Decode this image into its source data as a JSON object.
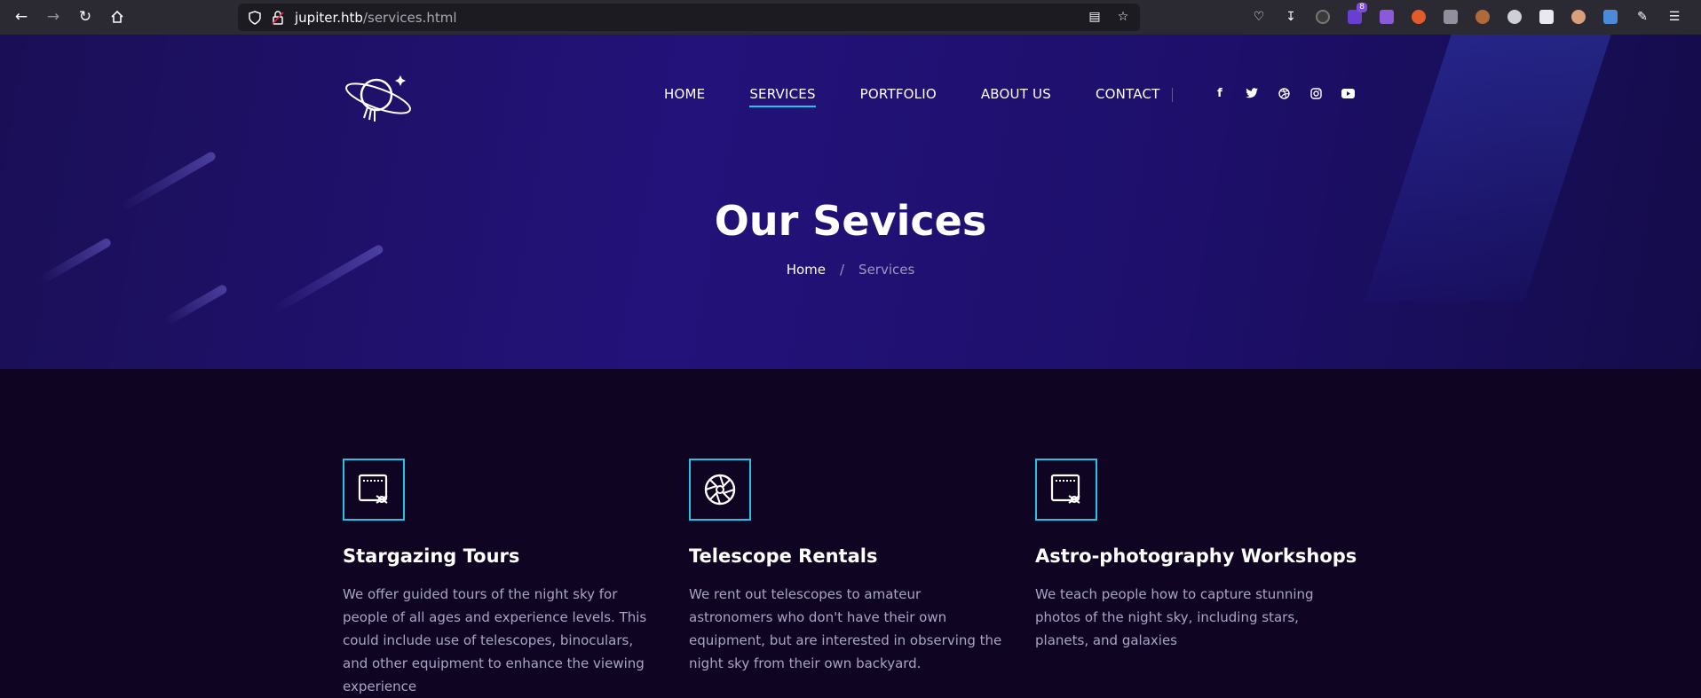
{
  "browser": {
    "back_icon": "back-arrow-icon",
    "forward_icon": "forward-arrow-icon",
    "reload_icon": "reload-icon",
    "home_icon": "home-icon",
    "url_host": "jupiter.htb",
    "url_path": "/services.html",
    "extension_badge": "8"
  },
  "nav": {
    "items": [
      {
        "label": "HOME",
        "active": false
      },
      {
        "label": "SERVICES",
        "active": true
      },
      {
        "label": "PORTFOLIO",
        "active": false
      },
      {
        "label": "ABOUT US",
        "active": false
      },
      {
        "label": "CONTACT",
        "active": false
      }
    ],
    "socials": [
      "facebook-icon",
      "twitter-icon",
      "dribbble-icon",
      "instagram-icon",
      "youtube-icon"
    ]
  },
  "hero": {
    "title": "Our Sevices",
    "breadcrumb_home": "Home",
    "breadcrumb_sep": "/",
    "breadcrumb_current": "Services"
  },
  "services": [
    {
      "title": "Stargazing Tours",
      "description": "We offer guided tours of the night sky for people of all ages and experience levels. This could include use of telescopes, binoculars, and other equipment to enhance the viewing experience",
      "icon": "photo-edit-icon"
    },
    {
      "title": "Telescope Rentals",
      "description": "We rent out telescopes to amateur astronomers who don't have their own equipment, but are interested in observing the night sky from their own backyard.",
      "icon": "aperture-icon"
    },
    {
      "title": "Astro-photography Workshops",
      "description": "We teach people how to capture stunning photos of the night sky, including stars, planets, and galaxies",
      "icon": "photo-edit-icon"
    }
  ],
  "colors": {
    "accent": "#22c4e6",
    "hero_bg": "#1d0f6a",
    "page_bg": "#0f0523"
  }
}
